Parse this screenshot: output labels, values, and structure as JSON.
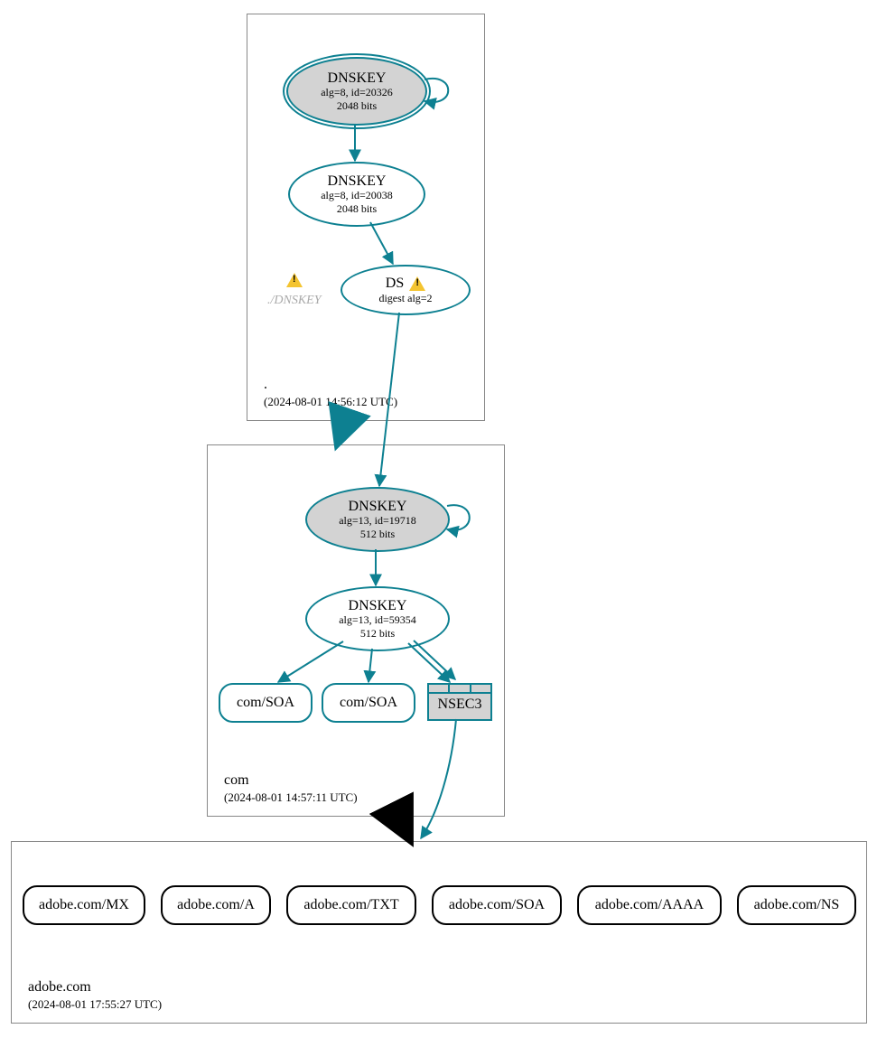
{
  "zones": {
    "root": {
      "name": ".",
      "timestamp": "(2024-08-01 14:56:12 UTC)"
    },
    "com": {
      "name": "com",
      "timestamp": "(2024-08-01 14:57:11 UTC)"
    },
    "adobe": {
      "name": "adobe.com",
      "timestamp": "(2024-08-01 17:55:27 UTC)"
    }
  },
  "nodes": {
    "root_ksk": {
      "title": "DNSKEY",
      "sub1": "alg=8, id=20326",
      "sub2": "2048 bits"
    },
    "root_zsk": {
      "title": "DNSKEY",
      "sub1": "alg=8, id=20038",
      "sub2": "2048 bits"
    },
    "root_missing": {
      "label": "./DNSKEY"
    },
    "ds": {
      "title": "DS",
      "sub1": "digest alg=2"
    },
    "com_ksk": {
      "title": "DNSKEY",
      "sub1": "alg=13, id=19718",
      "sub2": "512 bits"
    },
    "com_zsk": {
      "title": "DNSKEY",
      "sub1": "alg=13, id=59354",
      "sub2": "512 bits"
    },
    "com_soa1": {
      "label": "com/SOA"
    },
    "com_soa2": {
      "label": "com/SOA"
    },
    "nsec3": {
      "label": "NSEC3"
    },
    "adobe_mx": {
      "label": "adobe.com/MX"
    },
    "adobe_a": {
      "label": "adobe.com/A"
    },
    "adobe_txt": {
      "label": "adobe.com/TXT"
    },
    "adobe_soa": {
      "label": "adobe.com/SOA"
    },
    "adobe_aaaa": {
      "label": "adobe.com/AAAA"
    },
    "adobe_ns": {
      "label": "adobe.com/NS"
    }
  }
}
